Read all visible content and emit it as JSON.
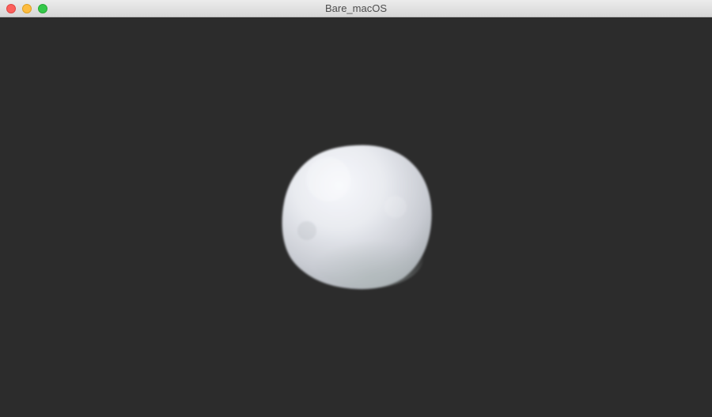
{
  "window": {
    "title": "Bare_macOS",
    "background_color": "#2c2c2c",
    "controls": {
      "close_color": "#fc605c",
      "minimize_color": "#fdbc40",
      "maximize_color": "#34c84a"
    }
  },
  "scene": {
    "object": "snowball-sphere",
    "object_color": "#e6e9ee"
  }
}
